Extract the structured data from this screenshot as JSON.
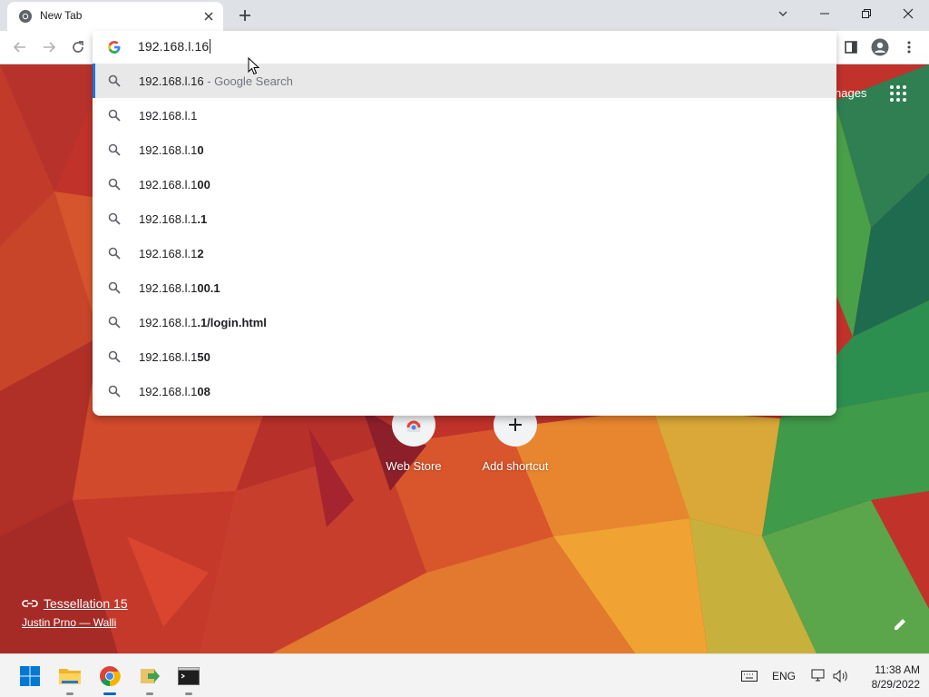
{
  "tab": {
    "title": "New Tab"
  },
  "omnibox": {
    "value": "192.168.l.16"
  },
  "suggestions": [
    {
      "prefix": "192.168.l.16",
      "bold": "",
      "suffix": " - Google Search",
      "selected": true
    },
    {
      "prefix": "192.168.l.1",
      "bold": "",
      "suffix": "",
      "selected": false
    },
    {
      "prefix": "192.168.l.1",
      "bold": "0",
      "suffix": "",
      "selected": false
    },
    {
      "prefix": "192.168.l.1",
      "bold": "00",
      "suffix": "",
      "selected": false
    },
    {
      "prefix": "192.168.l.1",
      "bold": ".1",
      "suffix": "",
      "selected": false
    },
    {
      "prefix": "192.168.l.1",
      "bold": "2",
      "suffix": "",
      "selected": false
    },
    {
      "prefix": "192.168.l.1",
      "bold": "00.1",
      "suffix": "",
      "selected": false
    },
    {
      "prefix": "192.168.l.1",
      "bold": ".1/login.html",
      "suffix": "",
      "selected": false
    },
    {
      "prefix": "192.168.l.1",
      "bold": "50",
      "suffix": "",
      "selected": false
    },
    {
      "prefix": "192.168.l.1",
      "bold": "08",
      "suffix": "",
      "selected": false
    }
  ],
  "ntp": {
    "images_link": "nages",
    "shortcuts": [
      {
        "label": "Web Store",
        "icon": "chrome-web-store-icon"
      },
      {
        "label": "Add shortcut",
        "icon": "plus-icon"
      }
    ],
    "attribution": {
      "title": "Tessellation 15",
      "author": "Justin Prno — Walli"
    }
  },
  "taskbar": {
    "apps": [
      "windows-start-icon",
      "file-explorer-icon",
      "chrome-icon",
      "app-arrow-icon",
      "terminal-icon"
    ],
    "language": "ENG",
    "time": "11:38 AM",
    "date": "8/29/2022"
  },
  "colors": {
    "accent": "#1a73e8",
    "tab_strip": "#dee1e6",
    "taskbar_active": "#0067c0"
  }
}
